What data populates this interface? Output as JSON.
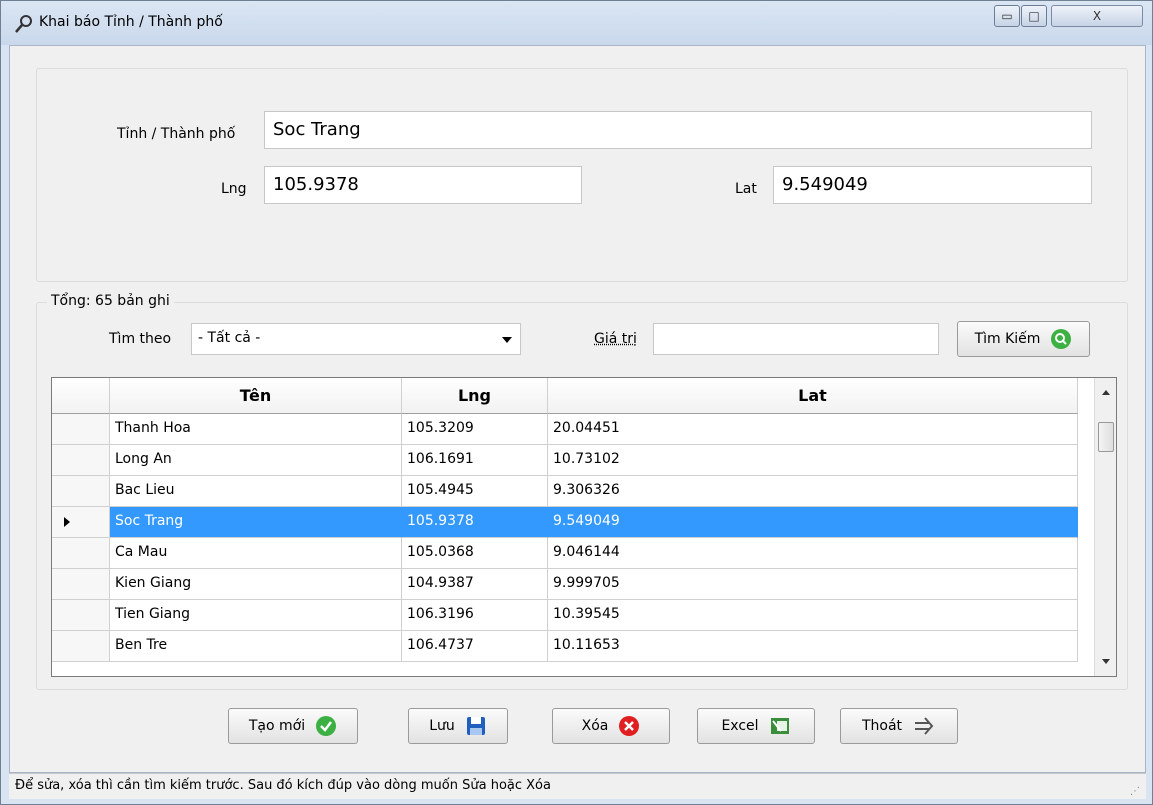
{
  "window": {
    "title": "Khai báo Tỉnh / Thành phố",
    "minimize_glyph": "▭",
    "maximize_glyph": "□",
    "close_glyph": "X"
  },
  "form": {
    "province_label": "Tỉnh / Thành phố",
    "province_value": "Soc Trang",
    "lng_label": "Lng",
    "lng_value": "105.9378",
    "lat_label": "Lat",
    "lat_value": "9.549049"
  },
  "search": {
    "total_label": "Tổng: 65 bản ghi",
    "search_by_label": "Tìm theo",
    "search_by_value": "- Tất cả -",
    "value_label": "Giá trị",
    "value_input": "",
    "search_button": "Tìm Kiếm"
  },
  "grid": {
    "columns": [
      "Tên",
      "Lng",
      "Lat"
    ],
    "rows": [
      [
        "Thanh Hoa",
        "105.3209",
        "20.04451"
      ],
      [
        "Long An",
        "106.1691",
        "10.73102"
      ],
      [
        "Bac Lieu",
        "105.4945",
        "9.306326"
      ],
      [
        "Soc Trang",
        "105.9378",
        "9.549049"
      ],
      [
        "Ca Mau",
        "105.0368",
        "9.046144"
      ],
      [
        "Kien Giang",
        "104.9387",
        "9.999705"
      ],
      [
        "Tien Giang",
        "106.3196",
        "10.39545"
      ],
      [
        "Ben Tre",
        "106.4737",
        "10.11653"
      ]
    ],
    "selected_row": 3
  },
  "buttons": {
    "new": "Tạo mới",
    "save": "Lưu",
    "delete": "Xóa",
    "excel": "Excel",
    "exit": "Thoát"
  },
  "status": {
    "text": "Để sửa, xóa thì cần tìm kiếm trước. Sau đó kích đúp vào dòng muốn Sửa hoặc Xóa"
  },
  "colors": {
    "selection": "#3399ff",
    "green_icon": "#3cb043",
    "red_icon": "#e02020",
    "blue_icon": "#1f5fbf"
  }
}
